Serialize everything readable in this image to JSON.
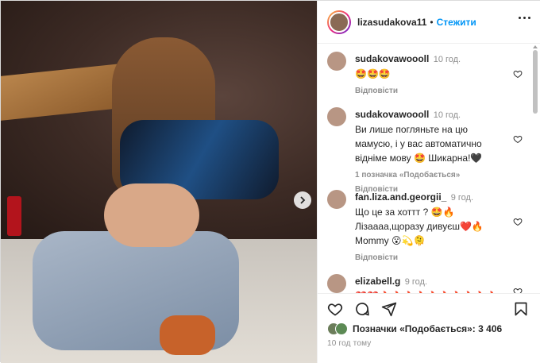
{
  "header": {
    "username": "lizasudakova11",
    "separator": "•",
    "follow_label": "Стежити"
  },
  "comments": [
    {
      "username": "sudakovawoooll",
      "time": "10 год.",
      "text": "🤩🤩🤩",
      "reply_label": "Відповісти",
      "likes_label": ""
    },
    {
      "username": "sudakovawoooll",
      "time": "10 год.",
      "text": "Ви лише погляньте на цю мамусю, і у вас автоматично відніме мову 🤩 Шикарна!🖤",
      "likes_label": "1 позначка «Подобається»",
      "reply_label": "Відповісти"
    },
    {
      "username": "fan.liza.and.georgii_",
      "time": "9 год.",
      "text": "Що це за хоттт ? 🤩🔥 Лізаааа,щоразу дивуєш❤️🔥 Mommy 😮💫🫠",
      "reply_label": "Відповісти",
      "likes_label": ""
    },
    {
      "username": "elizabell.g",
      "time": "9 год.",
      "text": "❤️❤️🔥🔥🔥🔥🔥🔥🔥🔥🔥🔥",
      "reply_label": "",
      "likes_label": ""
    }
  ],
  "footer": {
    "likes_prefix": "Позначки «Подобається»: ",
    "likes_count": "3 406",
    "time_ago": "10 год тому"
  },
  "icons": [
    "heart-icon",
    "comment-icon",
    "share-icon",
    "bookmark-icon",
    "chevron-right-icon",
    "more-icon"
  ]
}
